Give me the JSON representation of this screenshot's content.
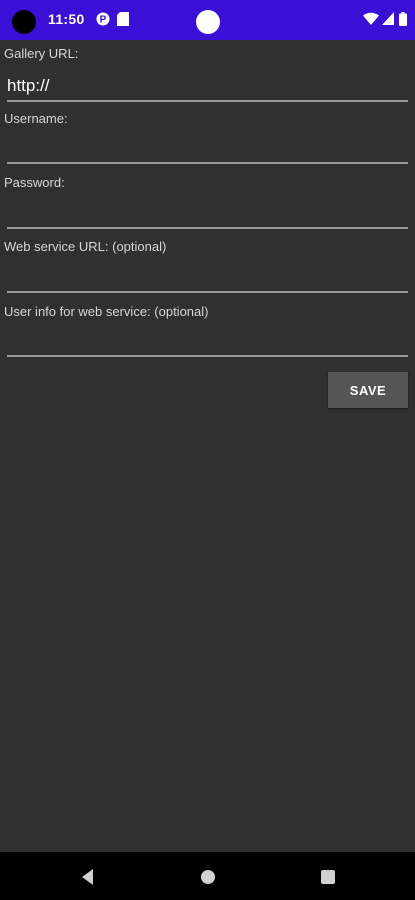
{
  "status_bar": {
    "time": "11:50",
    "background": "#3a0fd6",
    "icons": [
      "camera-cutout",
      "p-notification-icon",
      "sd-card-icon",
      "center-dot",
      "wifi-icon",
      "battery-icon"
    ]
  },
  "form": {
    "gallery_url": {
      "label": "Gallery URL:",
      "value": "http://"
    },
    "username": {
      "label": "Username:",
      "value": ""
    },
    "password": {
      "label": "Password:",
      "value": ""
    },
    "web_service_url": {
      "label": "Web service URL: (optional)",
      "value": ""
    },
    "user_info": {
      "label": "User info for web service: (optional)",
      "value": ""
    },
    "save_label": "SAVE"
  },
  "nav_bar": {
    "buttons": [
      "back-icon",
      "home-icon",
      "recents-icon"
    ]
  }
}
